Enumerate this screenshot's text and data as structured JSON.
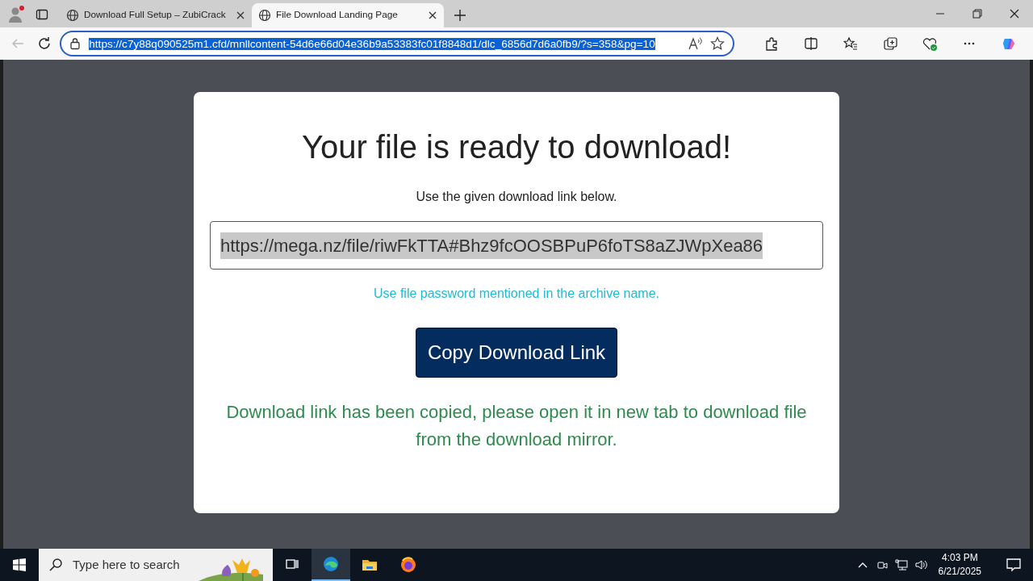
{
  "browser": {
    "tabs": [
      {
        "title": "Download Full Setup – ZubiCrack",
        "selected": false
      },
      {
        "title": "File Download Landing Page",
        "selected": true
      }
    ],
    "address": {
      "url": "https://c7y88q090525m1.cfd/mnllcontent-54d6e66d04e36b9a53383fc01f8848d1/dlc_6856d7d6a0fb9/?s=358&pg=10",
      "selected": true
    }
  },
  "page": {
    "heading": "Your file is ready to download!",
    "instruction": "Use the given download link below.",
    "link_field": {
      "value": "https://mega.nz/file/riwFkTTA#Bhz9fcOOSBPuP6foTS8aZJWpXea86",
      "selected": true
    },
    "password_note": "Use file password mentioned in the archive name.",
    "copy_button": "Copy Download Link",
    "copied_message": "Download link has been copied, please open it in new tab to download file from the download mirror."
  },
  "taskbar": {
    "search_placeholder": "Type here to search",
    "time": "4:03 PM",
    "date": "6/21/2025"
  }
}
